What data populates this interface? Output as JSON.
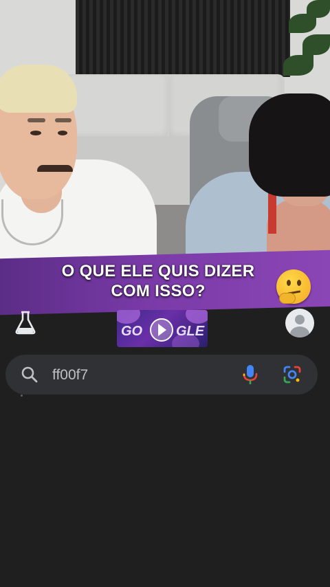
{
  "video": {
    "caption_line1": "O QUE ELE QUIS DIZER",
    "caption_line2": "COM ISSO?",
    "emoji": "thinking-face-emoji",
    "banner_color": "#7a3aa8"
  },
  "google": {
    "doodle_text_left": "GO",
    "doodle_text_right": "GLE",
    "search_query": "ff00f7",
    "icons": {
      "labs": "flask-icon",
      "search": "search-icon",
      "voice": "microphone-icon",
      "lens": "google-lens-icon",
      "account": "avatar-icon"
    }
  },
  "colors": {
    "background": "#1f1f1f",
    "searchbar": "#303134",
    "text": "#bdc1c6"
  }
}
